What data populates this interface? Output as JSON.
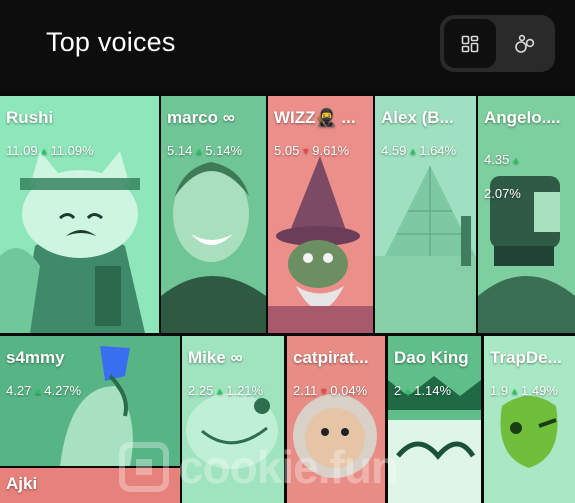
{
  "header": {
    "title": "Top voices"
  },
  "view_toggle": {
    "active": "grid",
    "icons": [
      "grid-layout-icon",
      "bubbles-layout-icon"
    ]
  },
  "colors": {
    "green": "#4fd097",
    "red": "#e5695f",
    "up": "#22c55e",
    "down": "#ef4444"
  },
  "tiles": [
    {
      "name": "Rushi",
      "value": "11.09",
      "trend": "up",
      "change": "11.09%",
      "color": "green"
    },
    {
      "name": "marco ∞",
      "value": "5.14",
      "trend": "up",
      "change": "5.14%",
      "color": "green"
    },
    {
      "name": "WIZZ🥷 ...",
      "value": "5.05",
      "trend": "down",
      "change": "9.61%",
      "color": "red"
    },
    {
      "name": "Alex (B...",
      "value": "4.59",
      "trend": "up",
      "change": "1.64%",
      "color": "green"
    },
    {
      "name": "Angelo....",
      "value": "4.35",
      "trend": "up",
      "change": "2.07%",
      "color": "green"
    },
    {
      "name": "s4mmy",
      "value": "4.27",
      "trend": "up",
      "change": "4.27%",
      "color": "green"
    },
    {
      "name": "Mike ∞",
      "value": "2.25",
      "trend": "up",
      "change": "1.21%",
      "color": "green"
    },
    {
      "name": "catpirat...",
      "value": "2.11",
      "trend": "down",
      "change": "0.04%",
      "color": "red"
    },
    {
      "name": "Dao King",
      "value": "2",
      "trend": "up",
      "change": "1.14%",
      "color": "green"
    },
    {
      "name": "TrapDe...",
      "value": "1.9",
      "trend": "up",
      "change": "1.49%",
      "color": "green"
    },
    {
      "name": "Ajki",
      "value": "",
      "trend": "up",
      "change": "",
      "color": "green"
    }
  ],
  "watermark": {
    "text": "cookie.fun"
  }
}
